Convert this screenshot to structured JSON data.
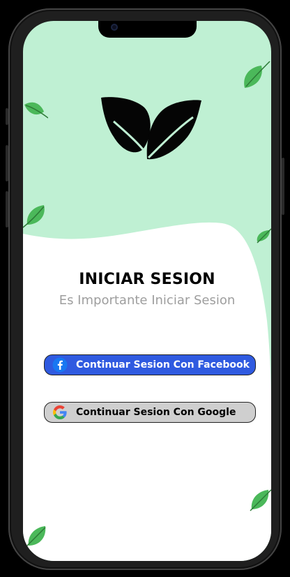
{
  "login": {
    "title": "INICIAR SESION",
    "subtitle": "Es Importante Iniciar Sesion"
  },
  "buttons": {
    "facebook_label": "Continuar Sesion Con Facebook",
    "google_label": "Continuar Sesion Con Google"
  },
  "colors": {
    "background_mint": "#bff0d3",
    "facebook_blue": "#2f5ae0",
    "google_button_gray": "#cfcfcf",
    "leaf_green": "#4bb85a",
    "subtitle_gray": "#9e9e9e"
  },
  "icons": {
    "logo": "leaves-logo-icon",
    "facebook": "facebook-icon",
    "google": "google-icon",
    "decoration": "leaf-icon"
  }
}
